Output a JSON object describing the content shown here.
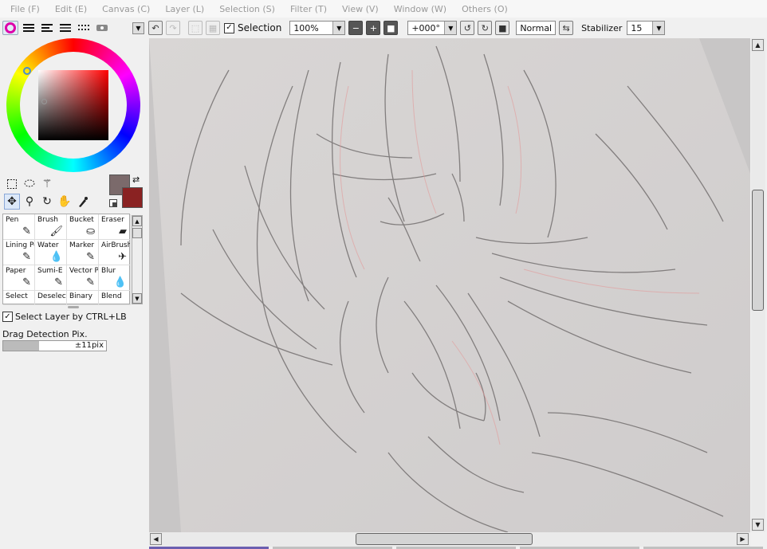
{
  "menu": [
    "File (F)",
    "Edit (E)",
    "Canvas (C)",
    "Layer (L)",
    "Selection (S)",
    "Filter (T)",
    "View (V)",
    "Window (W)",
    "Others (O)"
  ],
  "canvas_toolbar": {
    "selection_label": "Selection",
    "zoom_value": "100%",
    "angle_value": "+000°",
    "blend_mode": "Normal",
    "stabilizer_label": "Stabilizer",
    "stabilizer_value": "15"
  },
  "color_panel": {
    "fg_color": "#7b6a6b",
    "bg_color": "#8a2222",
    "hue_color": "#ff0000"
  },
  "brushes": [
    {
      "name": "Pen",
      "icon": "pen-icon"
    },
    {
      "name": "Brush",
      "icon": "brush-icon"
    },
    {
      "name": "Bucket",
      "icon": "bucket-icon"
    },
    {
      "name": "Eraser",
      "icon": "eraser-icon"
    },
    {
      "name": "Lining Pe",
      "icon": "lining-pen-icon"
    },
    {
      "name": "Water",
      "icon": "water-icon"
    },
    {
      "name": "Marker",
      "icon": "marker-icon"
    },
    {
      "name": "AirBrush",
      "icon": "airbrush-icon"
    },
    {
      "name": "Paper",
      "icon": "paper-icon"
    },
    {
      "name": "Sumi-E",
      "icon": "sumi-e-icon"
    },
    {
      "name": "Vector P",
      "icon": "vector-pen-icon"
    },
    {
      "name": "Blur",
      "icon": "blur-icon"
    },
    {
      "name": "Select",
      "icon": ""
    },
    {
      "name": "Deselect",
      "icon": ""
    },
    {
      "name": "Binary",
      "icon": ""
    },
    {
      "name": "Blend",
      "icon": ""
    }
  ],
  "options": {
    "select_layer_label": "Select Layer by CTRL+LB",
    "drag_label": "Drag Detection Pix.",
    "drag_value": "±11pix",
    "drag_level": 0.35
  },
  "bottom_tabs": [
    {
      "color": "#6b5fb0"
    },
    {
      "color": "#c0c0c0"
    },
    {
      "color": "#c0c0c0"
    },
    {
      "color": "#c0c0c0"
    },
    {
      "color": "#c0c0c0"
    }
  ]
}
